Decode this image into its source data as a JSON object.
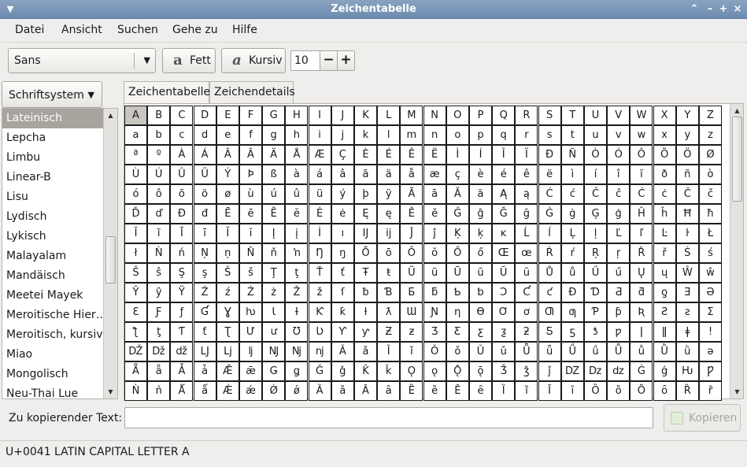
{
  "window": {
    "title": "Zeichentabelle"
  },
  "menubar": {
    "items": [
      "Datei",
      "Ansicht",
      "Suchen",
      "Gehe zu",
      "Hilfe"
    ]
  },
  "toolbar": {
    "font_family": "Sans",
    "bold_label": "Fett",
    "italic_label": "Kursiv",
    "size": "10",
    "decrement": "−",
    "increment": "+"
  },
  "sidebar": {
    "dropdown_label": "Schriftsystem",
    "scripts": [
      "Lateinisch",
      "Lepcha",
      "Limbu",
      "Linear-B",
      "Lisu",
      "Lydisch",
      "Lykisch",
      "Malayalam",
      "Mandäisch",
      "Meetei Mayek",
      "Meroitische Hier…",
      "Meroitisch, kursiv",
      "Miao",
      "Mongolisch",
      "Neu-Thai Lue"
    ],
    "selected": 0
  },
  "tabs": [
    {
      "label": "Zeichentabelle",
      "active": true
    },
    {
      "label": "Zeichendetails",
      "active": false
    }
  ],
  "grid": {
    "rows": [
      "A B C D E F G H I J K L M N O P Q R S T U V W X Y Z",
      "a b c d e f g h i j k l m n o p q r s t u v w x y z",
      "ª º À Á Â Ã Ä Å Æ Ç È É Ê Ë Ì Í Î Ï Ð Ñ Ò Ó Ô Õ Ö Ø",
      "Ù Ú Û Ü Ý Þ ß à á â ã ä å æ ç è é ê ë ì í î ï ð ñ ò",
      "ó ô õ ö ø ù ú û ü ý þ ÿ Ā ā Ă ă Ą ą Ć ć Ĉ ĉ Ċ ċ Č č",
      "Ď ď Đ đ Ē ē Ĕ ĕ Ė ė Ę ę Ě ě Ĝ ĝ Ğ ğ Ġ ġ Ģ ģ Ĥ ĥ Ħ ħ",
      "Ĩ ĩ Ī ī Ĭ ĭ Į į İ ı Ĳ ĳ Ĵ ĵ Ķ ķ ĸ Ĺ ĺ Ļ ļ Ľ ľ Ŀ ŀ Ł",
      "ł Ń ń Ņ ņ Ň ň ŉ Ŋ ŋ Ō ō Ŏ ŏ Ő ő Œ œ Ŕ ŕ Ŗ ŗ Ř ř Ś ś",
      "Ŝ ŝ Ş ş Š š Ţ ţ Ť ť Ŧ ŧ Ũ ũ Ū ū Ŭ ŭ Ů ů Ű ű Ų ų Ŵ ŵ",
      "Ŷ ŷ Ÿ Ź ź Ż ż Ž ž ſ ƀ Ɓ Ƃ ƃ Ƅ ƅ Ɔ Ƈ ƈ Ɖ Ɗ Ƌ ƌ ƍ Ǝ Ə",
      "Ɛ Ƒ ƒ Ɠ Ɣ ƕ Ɩ Ɨ Ƙ ƙ ƚ ƛ Ɯ Ɲ ƞ Ɵ Ơ ơ Ƣ ƣ Ƥ ƥ Ʀ Ƨ ƨ Ʃ",
      "ƪ ƫ Ƭ ƭ Ʈ Ư ư Ʊ Ʋ Ƴ ƴ Ƶ ƶ Ʒ Ƹ ƹ ƺ ƻ Ƽ ƽ ƾ ƿ ǀ ǁ ǂ ǃ",
      "Ǆ ǅ ǆ Ǉ ǈ ǉ Ǌ ǋ ǌ Ǎ ǎ Ǐ ǐ Ǒ ǒ Ǔ ǔ Ǖ ǖ Ǘ ǘ Ǚ ǚ Ǜ ǜ ǝ",
      "Ǟ ǟ Ǡ ǡ Ǣ ǣ Ǥ ǥ Ǧ ǧ Ǩ ǩ Ǫ ǫ Ǭ ǭ Ǯ ǯ ǰ Ǳ ǲ ǳ Ǵ ǵ Ƕ Ƿ",
      "Ǹ ǹ Ǻ ǻ Ǽ ǽ Ǿ ǿ Ȁ ȁ Ȃ ȃ Ȅ ȅ Ȇ ȇ Ȉ ȉ Ȋ ȋ Ȍ ȍ Ȏ ȏ Ȑ ȑ"
    ],
    "selected": [
      0,
      0
    ]
  },
  "copy": {
    "label": "Zu kopierender Text:",
    "value": "",
    "button_label": "Kopieren"
  },
  "status": {
    "text": "U+0041 LATIN CAPITAL LETTER A"
  }
}
